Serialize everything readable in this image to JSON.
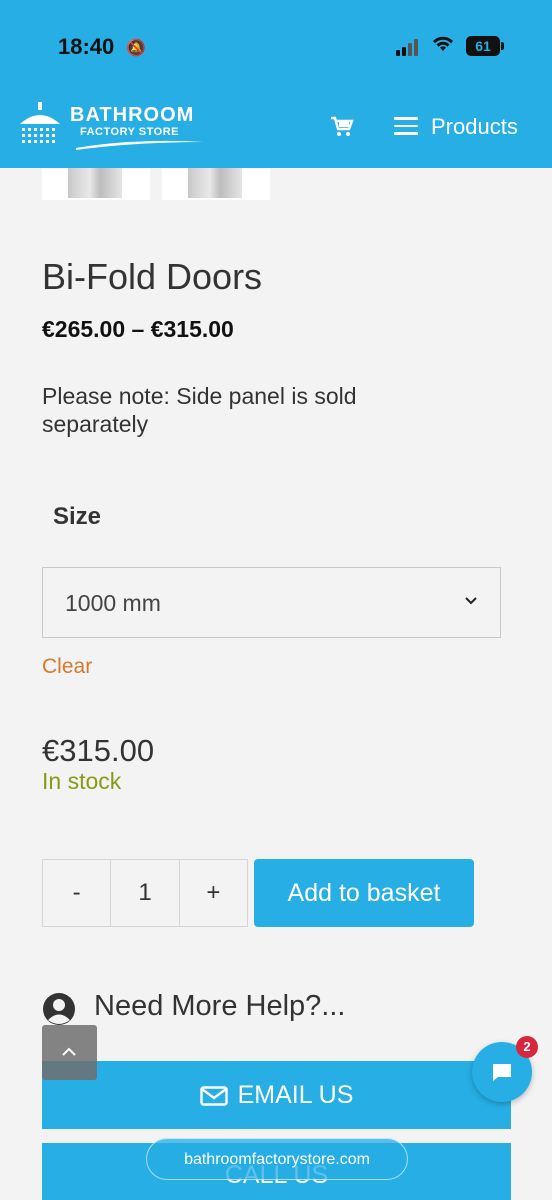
{
  "status_bar": {
    "time": "18:40",
    "battery": "61"
  },
  "header": {
    "logo_line1": "BATHROOM",
    "logo_line2": "FACTORY STORE",
    "menu_label": "Products",
    "brand_color": "#27aee4"
  },
  "product": {
    "title": "Bi-Fold Doors",
    "price_range": "€265.00 – €315.00",
    "note": "Please note: Side panel is sold separately",
    "size_label": "Size",
    "size_selected": "1000 mm",
    "clear_label": "Clear",
    "price": "€315.00",
    "stock": "In stock"
  },
  "quantity": {
    "minus": "-",
    "value": "1",
    "plus": "+"
  },
  "add_to_basket": "Add to basket",
  "help": {
    "heading": "Need More Help?...",
    "email_label": "EMAIL US",
    "call_label": "CALL US"
  },
  "chat": {
    "badge_count": "2"
  },
  "browser": {
    "url": "bathroomfactorystore.com"
  }
}
